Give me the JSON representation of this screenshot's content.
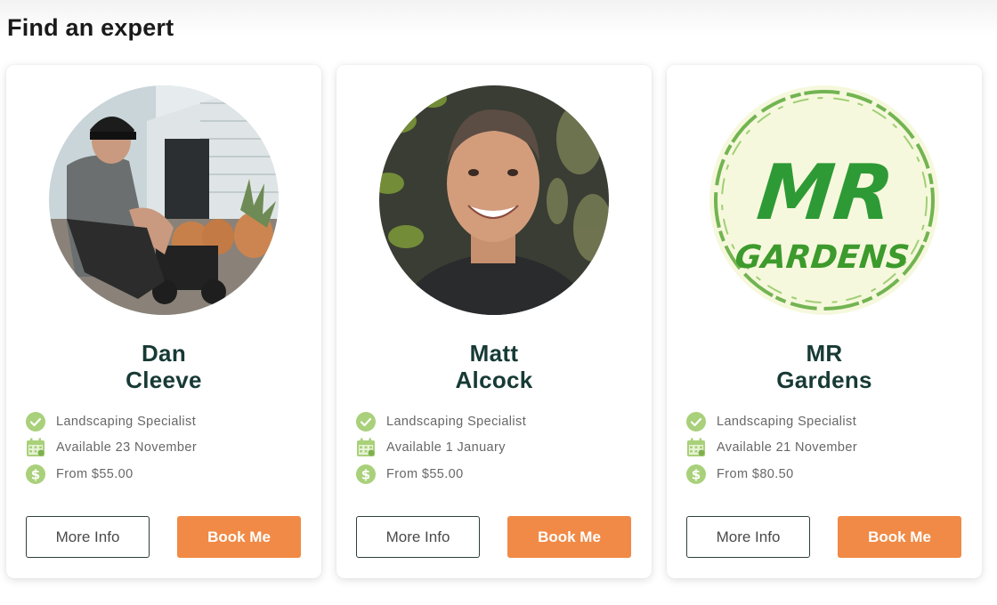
{
  "page": {
    "title": "Find an expert"
  },
  "experts": [
    {
      "first_name": "Dan",
      "last_name": "Cleeve",
      "specialty": "Landscaping Specialist",
      "availability": "Available 23 November",
      "price": "From $55.00",
      "more_info_label": "More Info",
      "book_label": "Book Me"
    },
    {
      "first_name": "Matt",
      "last_name": "Alcock",
      "specialty": "Landscaping Specialist",
      "availability": "Available 1 January",
      "price": "From $55.00",
      "more_info_label": "More Info",
      "book_label": "Book Me"
    },
    {
      "first_name": "MR",
      "last_name": "Gardens",
      "specialty": "Landscaping Specialist",
      "availability": "Available 21 November",
      "price": "From $80.50",
      "more_info_label": "More Info",
      "book_label": "Book Me",
      "logo_text": [
        "MR",
        "GARDENS"
      ]
    }
  ],
  "icons": {
    "specialty": "check-circle-icon",
    "availability": "calendar-icon",
    "price": "dollar-circle-icon"
  },
  "colors": {
    "accent": "#f08a46",
    "name": "#173a35",
    "icon_green": "#a9d07a",
    "logo_green": "#3a9b2c"
  }
}
